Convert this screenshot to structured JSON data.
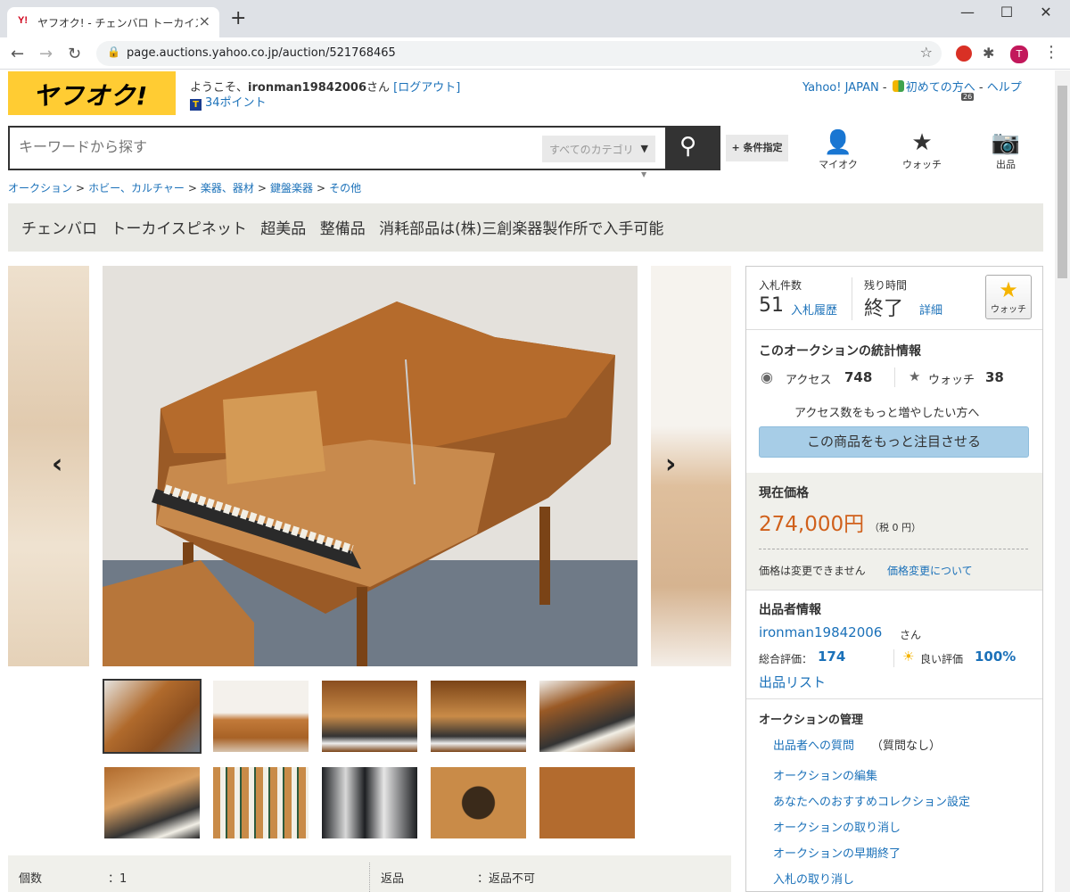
{
  "browser": {
    "tab_title": "ヤフオク! - チェンバロ トーカイスピネット",
    "tab_favicon": "Y!",
    "url": "page.auctions.yahoo.co.jp/auction/521768465",
    "ext_badge": "26",
    "profile_initial": "T"
  },
  "header": {
    "logo": "ヤフオク!",
    "welcome_prefix": "ようこそ、",
    "username": "ironman19842006",
    "welcome_suffix": "さん",
    "logout": "[ログアウト]",
    "points": "34ポイント",
    "links": {
      "yahoo_japan": "Yahoo! JAPAN",
      "beginners": "初めての方へ",
      "help": "ヘルプ"
    },
    "search_placeholder": "キーワードから探す",
    "category": "すべてのカテゴリ",
    "condition_button": "+ 条件指定",
    "icons": [
      {
        "name": "myauc",
        "label": "マイオク"
      },
      {
        "name": "watch",
        "label": "ウォッチ"
      },
      {
        "name": "sell",
        "label": "出品"
      }
    ]
  },
  "breadcrumb": [
    "オークション",
    "ホビー、カルチャー",
    "楽器、器材",
    "鍵盤楽器",
    "その他"
  ],
  "item_title": "チェンバロ トーカイスピネット 超美品 整備品 消耗部品は(株)三創楽器製作所で入手可能",
  "specs": {
    "qty_label": "個数",
    "qty_value": "：1",
    "return_label": "返品",
    "return_value": "：返品不可"
  },
  "panel": {
    "bids_label": "入札件数",
    "bids_value": "51",
    "bid_history": "入札履歴",
    "time_label": "残り時間",
    "time_value": "終了",
    "time_detail": "詳細",
    "watch_button": "ウォッチ",
    "stats_title": "このオークションの統計情報",
    "access_label": "アクセス",
    "access_value": "748",
    "watch_label": "ウォッチ",
    "watch_value": "38",
    "promo_text": "アクセス数をもっと増やしたい方へ",
    "promo_button": "この商品をもっと注目させる",
    "price_title": "現在価格",
    "price": "274,000円",
    "tax": "（税 0 円）",
    "price_note": "価格は変更できません",
    "price_link": "価格変更について",
    "seller_title": "出品者情報",
    "seller_name": "ironman19842006",
    "seller_suffix": "さん",
    "rating_label": "総合評価：",
    "rating_value": "174",
    "good_label": "良い評価",
    "good_value": "100%",
    "listing_link": "出品リスト",
    "manage_title": "オークションの管理",
    "manage_links": [
      "出品者への質問",
      "オークションの編集",
      "あなたへのおすすめコレクション設定",
      "オークションの取り消し",
      "オークションの早期終了",
      "入札の取り消し"
    ],
    "question_note": "（質問なし）"
  }
}
